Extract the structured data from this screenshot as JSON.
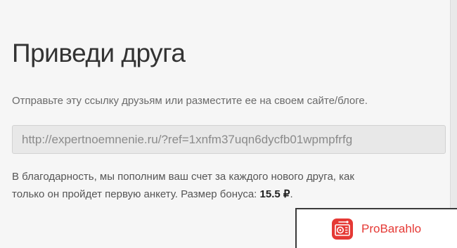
{
  "invite": {
    "title": "Приведи друга",
    "instructions": "Отправьте эту ссылку друзьям или разместите ее на своем сайте/блоге.",
    "ref_link": "http://expertnoemnenie.ru/?ref=1xnfm37uqn6dycfb01wpmpfrfg",
    "bonus_line_1": "В благодарность, мы пополним ваш счет за каждого нового друга, как",
    "bonus_line_2": "только он пройдет первую анкету. Размер бонуса: ",
    "bonus_amount": "15.5 ₽",
    "bonus_end": "."
  },
  "watermark": {
    "text": "ProBarahlo",
    "accent_color": "#e53935",
    "icon": "radio-icon"
  }
}
